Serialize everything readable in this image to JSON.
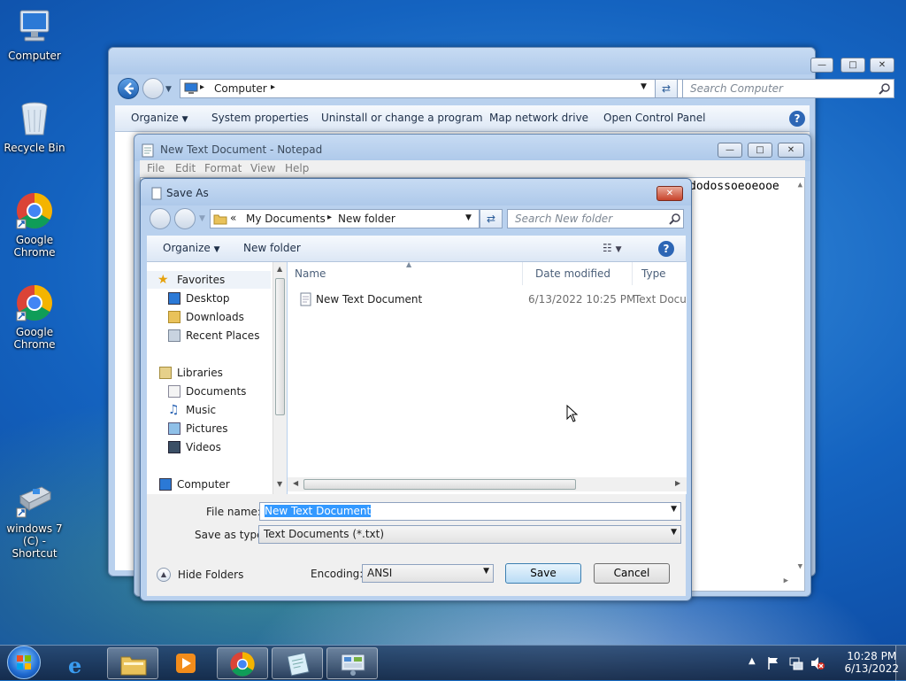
{
  "desktop": {
    "icons": [
      {
        "label": "Computer",
        "icon": "computer-icon"
      },
      {
        "label": "Recycle Bin",
        "icon": "recycle-bin-icon"
      },
      {
        "label": "Google Chrome",
        "icon": "chrome-icon"
      },
      {
        "label": "Google Chrome",
        "icon": "chrome-icon"
      },
      {
        "label": "windows 7 (C) - Shortcut",
        "icon": "drive-shortcut-icon"
      }
    ]
  },
  "explorer": {
    "address": "Computer",
    "search_placeholder": "Search Computer",
    "commands": [
      "Organize",
      "System properties",
      "Uninstall or change a program",
      "Map network drive",
      "Open Control Panel"
    ]
  },
  "notepad": {
    "title": "New Text Document - Notepad",
    "menu": [
      "File",
      "Edit",
      "Format",
      "View",
      "Help"
    ],
    "text": "dodossoeoeooe"
  },
  "save_dialog": {
    "title": "Save As",
    "breadcrumb": [
      "My Documents",
      "New folder"
    ],
    "search_placeholder": "Search New folder",
    "organize_label": "Organize",
    "new_folder_label": "New folder",
    "nav": {
      "favorites_header": "Favorites",
      "favorites": [
        "Desktop",
        "Downloads",
        "Recent Places"
      ],
      "libraries_header": "Libraries",
      "libraries": [
        "Documents",
        "Music",
        "Pictures",
        "Videos"
      ],
      "computer_header": "Computer"
    },
    "columns": [
      "Name",
      "Date modified",
      "Type"
    ],
    "files": [
      {
        "name": "New Text Document",
        "date": "6/13/2022 10:25 PM",
        "type": "Text Docu"
      }
    ],
    "file_name_label": "File name:",
    "file_name_value": "New Text Document",
    "save_type_label": "Save as type:",
    "save_type_value": "Text Documents (*.txt)",
    "hide_folders_label": "Hide Folders",
    "encoding_label": "Encoding:",
    "encoding_value": "ANSI",
    "save_label": "Save",
    "cancel_label": "Cancel"
  },
  "taskbar": {
    "time": "10:28 PM",
    "date": "6/13/2022",
    "pinned": [
      "start-orb-icon",
      "internet-explorer-icon",
      "windows-explorer-icon",
      "media-player-icon",
      "chrome-icon",
      "notepad-icon",
      "control-panel-icon"
    ]
  }
}
